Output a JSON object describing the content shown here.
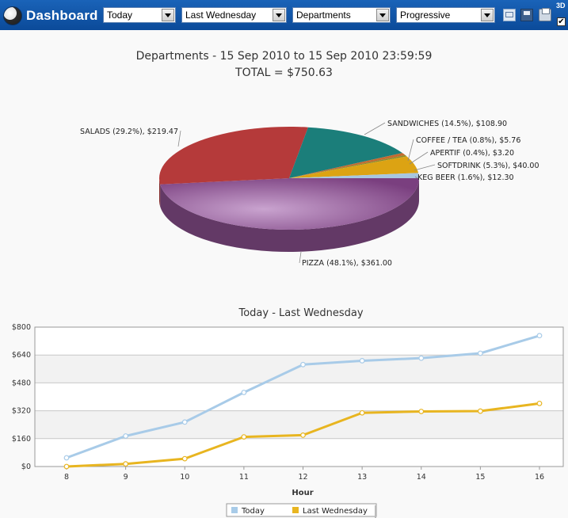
{
  "toolbar": {
    "title": "Dashboard",
    "selects": [
      {
        "name": "period",
        "value": "Today"
      },
      {
        "name": "compare",
        "value": "Last Wednesday"
      },
      {
        "name": "grouping",
        "value": "Departments"
      },
      {
        "name": "mode",
        "value": "Progressive"
      }
    ],
    "icons": [
      "email-icon",
      "save-icon",
      "print-icon"
    ],
    "three_d_label": "3D",
    "three_d_checked": "✔"
  },
  "chart_data": [
    {
      "type": "pie",
      "title": "Departments - 15 Sep 2010 to 15 Sep 2010 23:59:59",
      "subtitle": "TOTAL = $750.63",
      "slices": [
        {
          "label": "PIZZA (48.1%), $361.00",
          "name": "PIZZA",
          "value": 361.0,
          "color": "#8a4f8e"
        },
        {
          "label": "SALADS (29.2%), $219.47",
          "name": "SALADS",
          "value": 219.47,
          "color": "#b53a3a"
        },
        {
          "label": "SANDWICHES (14.5%), $108.90",
          "name": "SANDWICHES",
          "value": 108.9,
          "color": "#1b7e7a"
        },
        {
          "label": "COFFEE / TEA (0.8%), $5.76",
          "name": "COFFEE / TEA",
          "value": 5.76,
          "color": "#c46a30"
        },
        {
          "label": "APERTIF (0.4%), $3.20",
          "name": "APERTIF",
          "value": 3.2,
          "color": "#8c8c2a"
        },
        {
          "label": "SOFTDRINK (5.3%), $40.00",
          "name": "SOFTDRINK",
          "value": 40.0,
          "color": "#dca313"
        },
        {
          "label": "KEG BEER (1.6%), $12.30",
          "name": "KEG BEER",
          "value": 12.3,
          "color": "#a8c7e0"
        }
      ]
    },
    {
      "type": "line",
      "title": "Today - Last Wednesday",
      "xlabel": "Hour",
      "ylabel": "",
      "x": [
        8,
        9,
        10,
        11,
        12,
        13,
        14,
        15,
        16
      ],
      "ylim": [
        0,
        800
      ],
      "yticks": [
        0,
        160,
        320,
        480,
        640,
        800
      ],
      "ytick_labels": [
        "$0",
        "$160",
        "$320",
        "$480",
        "$640",
        "$800"
      ],
      "series": [
        {
          "name": "Today",
          "color": "#a8cbe8",
          "values": [
            50,
            175,
            255,
            425,
            585,
            607,
            622,
            650,
            751
          ]
        },
        {
          "name": "Last Wednesday",
          "color": "#e8b520",
          "values": [
            0,
            15,
            45,
            170,
            180,
            308,
            316,
            318,
            362
          ]
        }
      ],
      "legend": "bottom-center",
      "grid": true
    }
  ]
}
